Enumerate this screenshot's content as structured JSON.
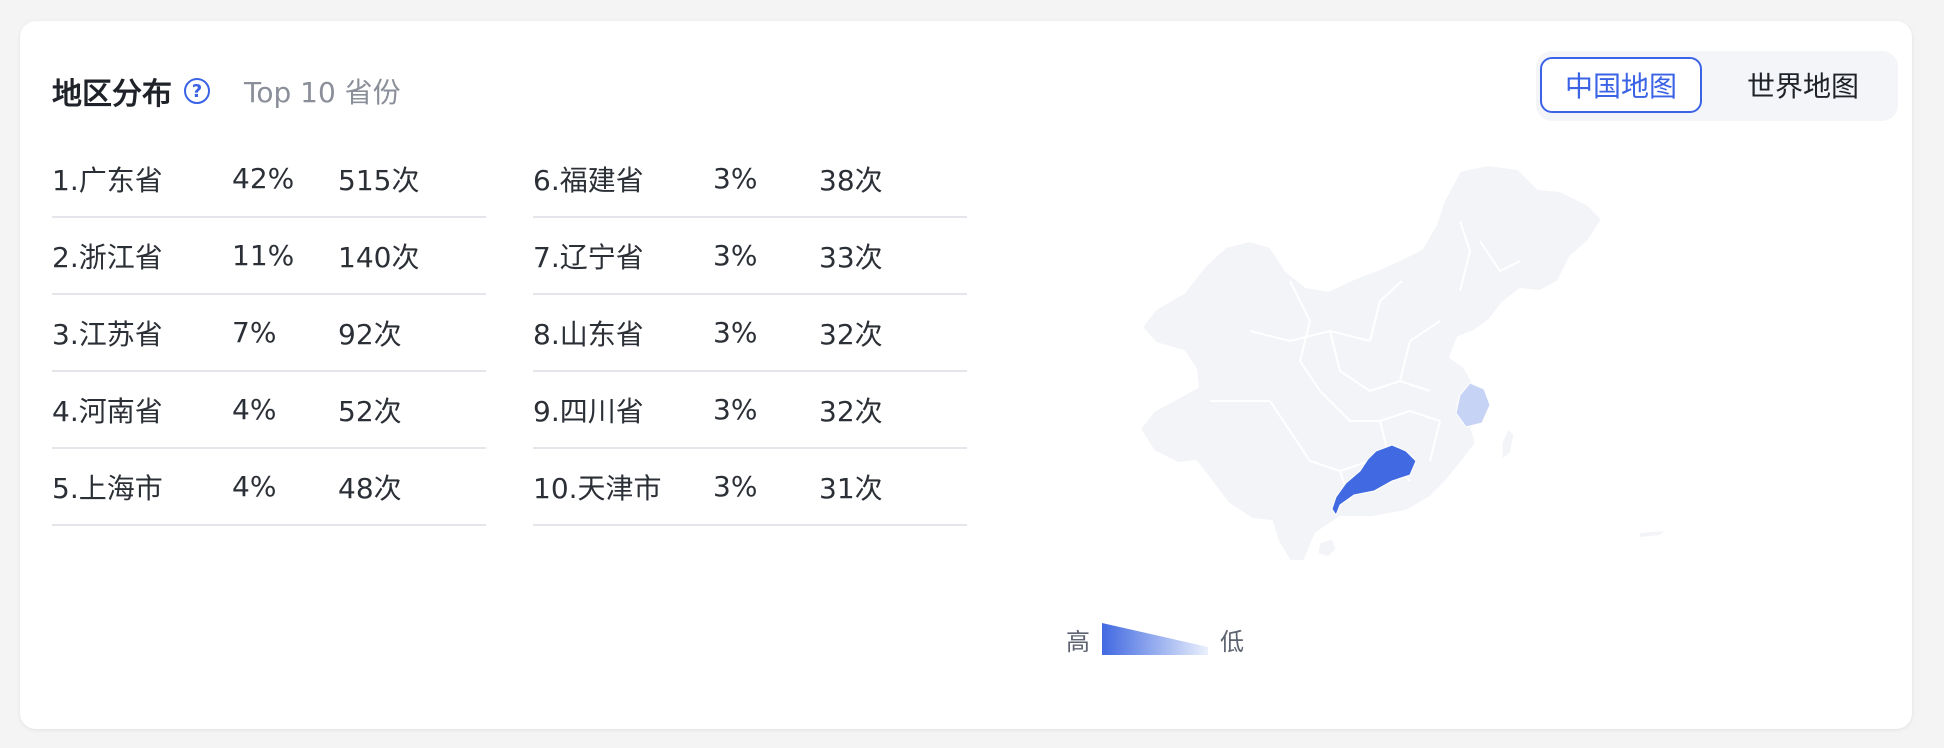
{
  "header": {
    "title": "地区分布",
    "help_icon": "question-circle-icon",
    "subtitle": "Top 10 省份"
  },
  "map_switch": {
    "active": "中国地图",
    "inactive": "世界地图"
  },
  "ranking": {
    "left": [
      {
        "name": "1.广东省",
        "percent": "42%",
        "count": "515次"
      },
      {
        "name": "2.浙江省",
        "percent": "11%",
        "count": "140次"
      },
      {
        "name": "3.江苏省",
        "percent": "7%",
        "count": "92次"
      },
      {
        "name": "4.河南省",
        "percent": "4%",
        "count": "52次"
      },
      {
        "name": "5.上海市",
        "percent": "4%",
        "count": "48次"
      }
    ],
    "right": [
      {
        "name": "6.福建省",
        "percent": "3%",
        "count": "38次"
      },
      {
        "name": "7.辽宁省",
        "percent": "3%",
        "count": "33次"
      },
      {
        "name": "8.山东省",
        "percent": "3%",
        "count": "32次"
      },
      {
        "name": "9.四川省",
        "percent": "3%",
        "count": "32次"
      },
      {
        "name": "10.天津市",
        "percent": "3%",
        "count": "31次"
      }
    ]
  },
  "legend": {
    "high": "高",
    "low": "低"
  },
  "colors": {
    "accent": "#3b63e6",
    "map_base": "#f3f4f8",
    "map_high": "#4169e1",
    "map_mid": "#c7d3f5"
  }
}
